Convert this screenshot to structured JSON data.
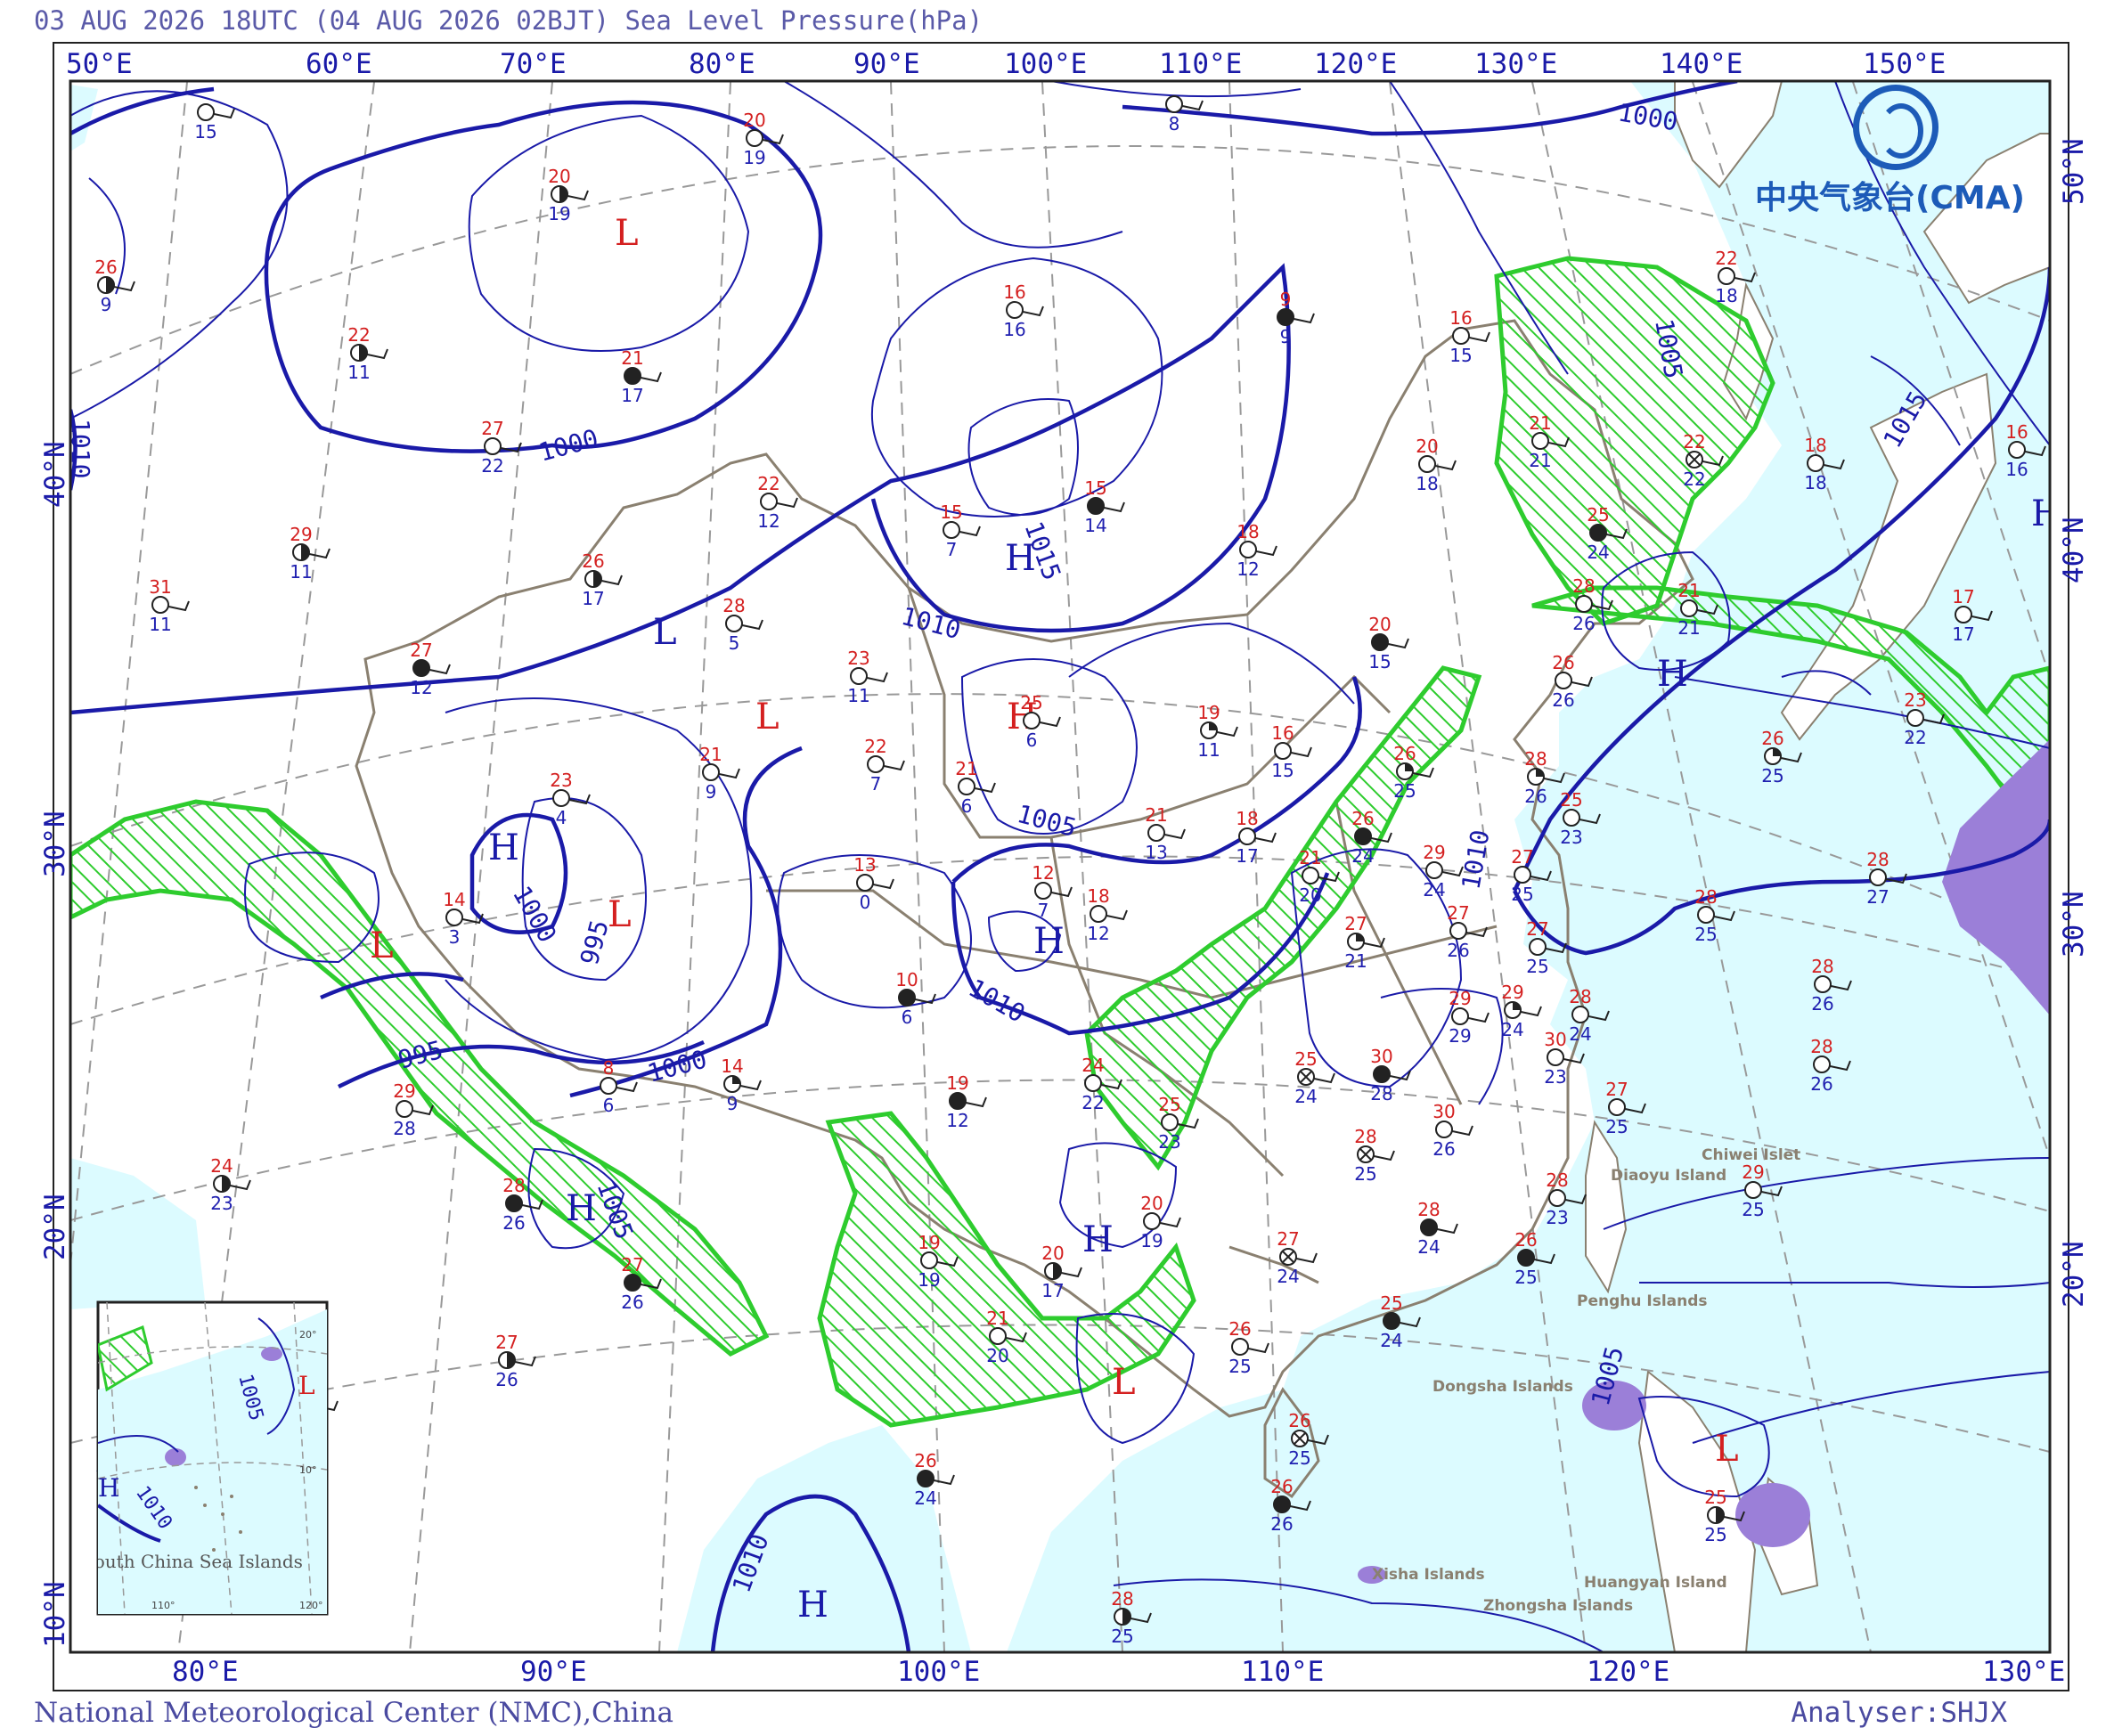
{
  "header": {
    "title": "03 AUG 2026 18UTC (04 AUG 2026 02BJT) Sea Level Pressure(hPa)"
  },
  "footer": {
    "left": "National Meteorological Center (NMC),China",
    "right": "Analyser:SHJX"
  },
  "logo": {
    "text": "中央气象台(CMA)"
  },
  "colors": {
    "isobar": "#1a1aa8",
    "sea": "#dcfbff",
    "land": "#ffffff",
    "border": "#8a8070",
    "rain_area": "#2ecc2e",
    "convective": "#9b7fd8",
    "temperature": "#d42020",
    "dewpoint": "#2020b0",
    "system_label": "#d42020",
    "graticule": "#999999"
  },
  "top_lon_labels": [
    "50°E",
    "60°E",
    "70°E",
    "80°E",
    "90°E",
    "100°E",
    "110°E",
    "120°E",
    "130°E",
    "140°E",
    "150°E"
  ],
  "bottom_lon_labels": [
    "80°E",
    "90°E",
    "100°E",
    "110°E",
    "120°E",
    "130°E"
  ],
  "left_lat_labels": [
    "40°N",
    "30°N",
    "20°N",
    "10°N"
  ],
  "right_lat_labels": [
    "50°N",
    "40°N",
    "30°N",
    "20°N"
  ],
  "isobar_labels": [
    "1000",
    "1000",
    "1000",
    "995",
    "995",
    "1000",
    "1005",
    "1005",
    "1010",
    "1010",
    "1010",
    "1015",
    "1005",
    "1010",
    "1015",
    "1005",
    "1010"
  ],
  "pressure_systems": [
    {
      "type": "L"
    },
    {
      "type": "H"
    },
    {
      "type": "L"
    },
    {
      "type": "L"
    },
    {
      "type": "H"
    },
    {
      "type": "L"
    },
    {
      "type": "L"
    },
    {
      "type": "H"
    },
    {
      "type": "H"
    },
    {
      "type": "H"
    },
    {
      "type": "H"
    },
    {
      "type": "H"
    },
    {
      "type": "L"
    },
    {
      "type": "L"
    },
    {
      "type": "H"
    },
    {
      "type": "H"
    },
    {
      "type": "L"
    },
    {
      "type": "H"
    }
  ],
  "place_labels": [
    "Chiwei Islet",
    "Diaoyu Island",
    "Penghu Islands",
    "Dongsha Islands",
    "Xisha Islands",
    "Huangyan Island",
    "Zhongsha Islands",
    "South China Sea Islands"
  ],
  "stations": [
    {
      "t": "",
      "td": "15"
    },
    {
      "t": "",
      "td": "8"
    },
    {
      "t": "20",
      "td": "19"
    },
    {
      "t": "20",
      "td": "19"
    },
    {
      "t": "26",
      "td": "9"
    },
    {
      "t": "22",
      "td": "11"
    },
    {
      "t": "21",
      "td": "17"
    },
    {
      "t": "16",
      "td": "16"
    },
    {
      "t": "9",
      "td": "9"
    },
    {
      "t": "16",
      "td": "15"
    },
    {
      "t": "22",
      "td": "18"
    },
    {
      "t": "27",
      "td": "22"
    },
    {
      "t": "22",
      "td": "12"
    },
    {
      "t": "15",
      "td": "7"
    },
    {
      "t": "15",
      "td": "14"
    },
    {
      "t": "21",
      "td": "21"
    },
    {
      "t": "20",
      "td": "18"
    },
    {
      "t": "22",
      "td": "22"
    },
    {
      "t": "18",
      "td": "18"
    },
    {
      "t": "16",
      "td": "16"
    },
    {
      "t": "29",
      "td": "11"
    },
    {
      "t": "31",
      "td": "11"
    },
    {
      "t": "26",
      "td": "17"
    },
    {
      "t": "28",
      "td": "5"
    },
    {
      "t": "18",
      "td": "12"
    },
    {
      "t": "25",
      "td": "24"
    },
    {
      "t": "28",
      "td": "26"
    },
    {
      "t": "17",
      "td": "17"
    },
    {
      "t": "21",
      "td": "21"
    },
    {
      "t": "20",
      "td": "15"
    },
    {
      "t": "27",
      "td": "12"
    },
    {
      "t": "23",
      "td": "11"
    },
    {
      "t": "25",
      "td": "6"
    },
    {
      "t": "19",
      "td": "11"
    },
    {
      "t": "26",
      "td": "26"
    },
    {
      "t": "16",
      "td": "15"
    },
    {
      "t": "26",
      "td": "25"
    },
    {
      "t": "23",
      "td": "22"
    },
    {
      "t": "26",
      "td": "25"
    },
    {
      "t": "21",
      "td": "9"
    },
    {
      "t": "22",
      "td": "7"
    },
    {
      "t": "21",
      "td": "6"
    },
    {
      "t": "28",
      "td": "26"
    },
    {
      "t": "23",
      "td": "4"
    },
    {
      "t": "25",
      "td": "23"
    },
    {
      "t": "21",
      "td": "13"
    },
    {
      "t": "18",
      "td": "17"
    },
    {
      "t": "21",
      "td": "20"
    },
    {
      "t": "26",
      "td": "24"
    },
    {
      "t": "29",
      "td": "24"
    },
    {
      "t": "27",
      "td": "25"
    },
    {
      "t": "28",
      "td": "27"
    },
    {
      "t": "27",
      "td": "26"
    },
    {
      "t": "14",
      "td": "3"
    },
    {
      "t": "13",
      "td": "0"
    },
    {
      "t": "12",
      "td": "7"
    },
    {
      "t": "18",
      "td": "12"
    },
    {
      "t": "28",
      "td": "25"
    },
    {
      "t": "27",
      "td": "21"
    },
    {
      "t": "28",
      "td": "26"
    },
    {
      "t": "27",
      "td": "25"
    },
    {
      "t": "10",
      "td": "6"
    },
    {
      "t": "29",
      "td": "29"
    },
    {
      "t": "29",
      "td": "24"
    },
    {
      "t": "28",
      "td": "24"
    },
    {
      "t": "30",
      "td": "23"
    },
    {
      "t": "28",
      "td": "26"
    },
    {
      "t": "8",
      "td": "6"
    },
    {
      "t": "14",
      "td": "9"
    },
    {
      "t": "29",
      "td": "28"
    },
    {
      "t": "19",
      "td": "12"
    },
    {
      "t": "24",
      "td": "22"
    },
    {
      "t": "25",
      "td": "24"
    },
    {
      "t": "30",
      "td": "28"
    },
    {
      "t": "25",
      "td": "23"
    },
    {
      "t": "27",
      "td": "25"
    },
    {
      "t": "24",
      "td": "23"
    },
    {
      "t": "28",
      "td": "25"
    },
    {
      "t": "30",
      "td": "26"
    },
    {
      "t": "28",
      "td": "23"
    },
    {
      "t": "29",
      "td": "25"
    },
    {
      "t": "28",
      "td": "26"
    },
    {
      "t": "20",
      "td": "19"
    },
    {
      "t": "27",
      "td": "24"
    },
    {
      "t": "28",
      "td": "24"
    },
    {
      "t": "26",
      "td": "25"
    },
    {
      "t": "19",
      "td": "19"
    },
    {
      "t": "20",
      "td": "17"
    },
    {
      "t": "27",
      "td": "26"
    },
    {
      "t": "25",
      "td": "24"
    },
    {
      "t": "21",
      "td": "20"
    },
    {
      "t": "26",
      "td": "25"
    },
    {
      "t": "27",
      "td": "26"
    },
    {
      "t": "26",
      "td": "25"
    },
    {
      "t": "26",
      "td": "24"
    },
    {
      "t": "26",
      "td": "26"
    },
    {
      "t": "28",
      "td": "25"
    },
    {
      "t": "25",
      "td": "25"
    },
    {
      "t": "26",
      "td": "24"
    },
    {
      "t": "26",
      "td": "25"
    },
    {
      "t": "26",
      "td": "26"
    },
    {
      "t": "26",
      "td": "25"
    }
  ],
  "inset": {
    "lon_labels": [
      "110°",
      "120°"
    ],
    "lat_labels": [
      "20°",
      "10°"
    ],
    "isobar_labels": [
      "1005",
      "1010"
    ],
    "systems": [
      "L",
      "H"
    ]
  }
}
